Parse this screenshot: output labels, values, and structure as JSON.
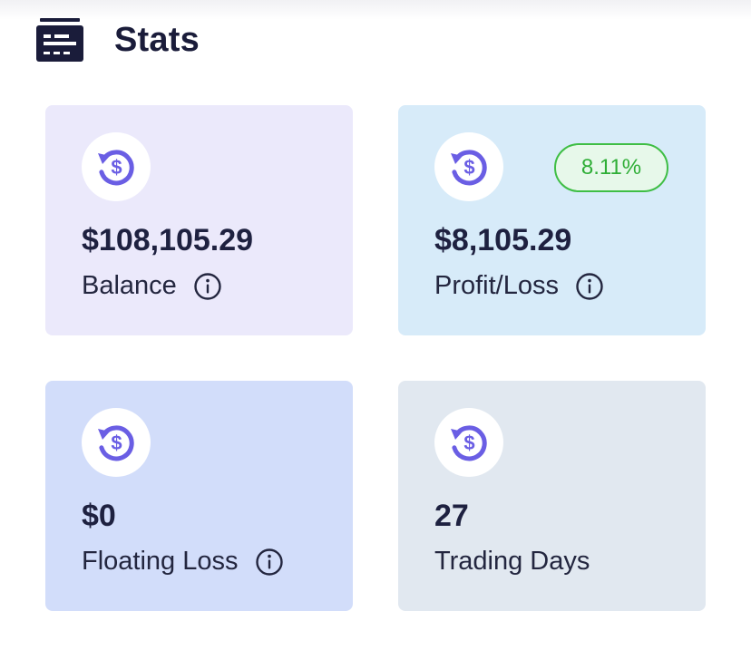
{
  "header": {
    "title": "Stats",
    "icon": "dashboard-card-icon"
  },
  "cards": [
    {
      "icon": "dollar-refresh-icon",
      "value": "$108,105.29",
      "label": "Balance",
      "has_info": true
    },
    {
      "icon": "dollar-refresh-icon",
      "value": "$8,105.29",
      "label": "Profit/Loss",
      "has_info": true,
      "badge": "8.11%"
    },
    {
      "icon": "dollar-refresh-icon",
      "value": "$0",
      "label": "Floating Loss",
      "has_info": true
    },
    {
      "icon": "dollar-refresh-icon",
      "value": "27",
      "label": "Trading Days",
      "has_info": false
    }
  ],
  "colors": {
    "accent": "#6a5ee4",
    "balance_bg": "#ebe9fb",
    "profit_bg": "#d7ebf9",
    "floating_bg": "#d2ddfa",
    "days_bg": "#e1e8f0",
    "badge_green": "#3fbe45",
    "text_dark": "#1e2140"
  }
}
